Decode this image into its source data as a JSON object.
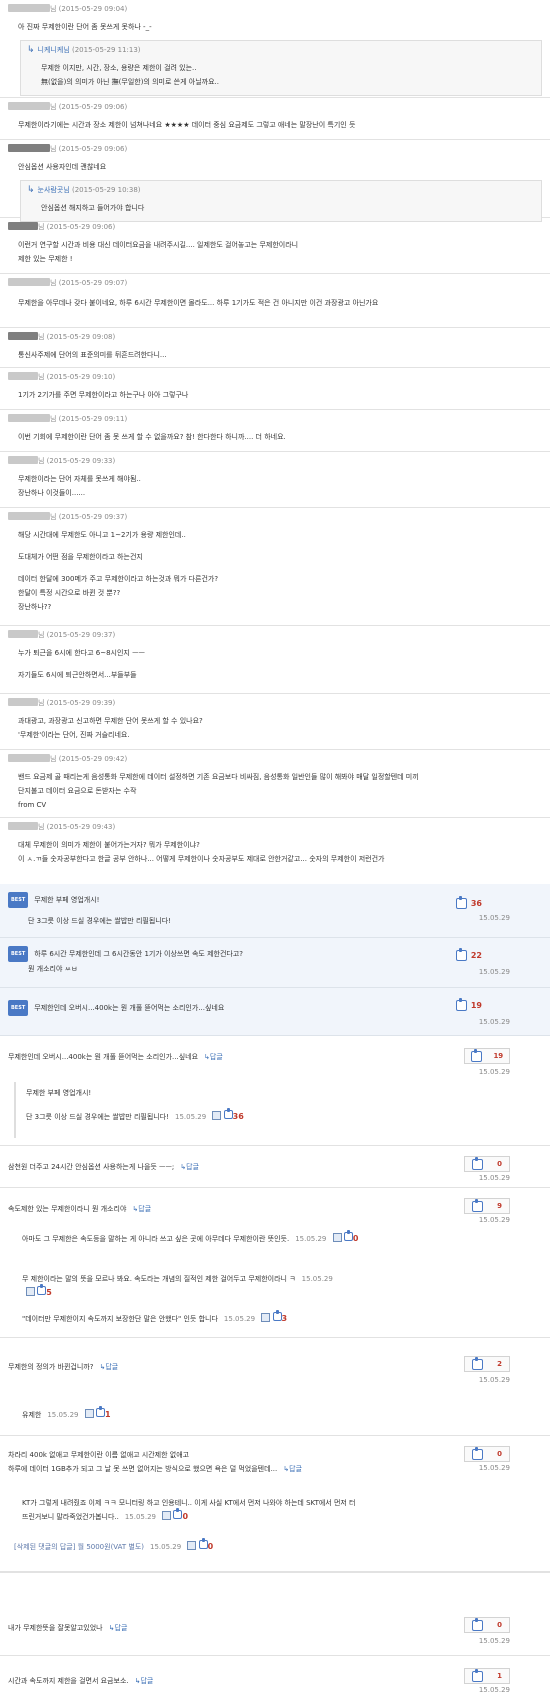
{
  "comments": [
    {
      "date": "(2015-05-29 09:04)",
      "text": "아 진짜 무제한이란 단어 좀 못쓰게 못하나 -_-",
      "reply": {
        "nick": "니케니케님",
        "date": "(2015-05-29 11:13)",
        "lines": [
          "무제한 이지만, 시간, 장소, 용량은 제한이 걸려 있는..",
          "無(없을)의 의미가 아닌 撫(무일한)의 의미로 쓴게 아닐까요.."
        ]
      }
    },
    {
      "nick_suffix": "님",
      "date": "(2015-05-29 09:06)",
      "text": "무제한이라기에는 시간과 장소 제한이 넘쳐나네요 ★★★★ 데이터 중심 요금제도 그렇고 애네는 말장난이 특기인 듯"
    },
    {
      "date": "(2015-05-29 09:06)",
      "text": "안심옵션 사용자인데 괜찮네요",
      "reply": {
        "nick": "눈사람곳님",
        "date": "(2015-05-29 10:38)",
        "lines": [
          "안심옵션 해지하고 들어가야 합니다"
        ]
      }
    },
    {
      "date": "(2015-05-29 09:06)",
      "lines": [
        "이런거 연구할 시간과 비용 대신 데이터요금을 내려주시길.... 일제한도 걸어놓고는 무제한이라니",
        "제한 있는 무제한 !"
      ]
    },
    {
      "nick_suffix": "님",
      "date": "(2015-05-29 09:07)",
      "text": "무제한을 아무데나 갖다 붙이네요, 하루 6시간 무제한이면 몰라도... 하루 1기가도 적은 건 아니지만 이건 과장광고 아닌가요"
    },
    {
      "date": "(2015-05-29 09:08)",
      "text": "통신사주제에 단어의 표준의미를 뒤흔드려한다니..."
    },
    {
      "date": "(2015-05-29 09:10)",
      "text": "1기가 2기가를 주면 무제한이라고 하는구나 아아 그렇구나"
    },
    {
      "date": "(2015-05-29 09:11)",
      "text": "이번 기회에 무제한이란 단어 좀 못 쓰게 할 수 없을까요? 참! 한다한다 하니까.... 더 하네요."
    },
    {
      "date": "(2015-05-29 09:33)",
      "lines": [
        "무제한이라는 단어 자체를 못쓰게 해야됨..",
        "장난하나 이것들이......"
      ]
    },
    {
      "nick_suffix": "님",
      "date": "(2015-05-29 09:37)",
      "paras": [
        [
          "해당 시간대에 무제한도 아니고 1~2기가 용량 제한인데.."
        ],
        [
          "도대체가 어떤 점을 무제한이라고 하는건지"
        ],
        [
          "데이터 한달에 300메가 주고 무제한이라고 하는것과 뭐가 다른건가?",
          "한달이 특정 시간으로 바뀐 것 뿐??",
          "장난하나??"
        ]
      ]
    },
    {
      "date": "(2015-05-29 09:37)",
      "paras": [
        [
          "누가 퇴근을 6시에 한다고 6~8시인지 ㅡㅡ"
        ],
        [
          "자기들도 6시에 퇴근안하면서...부들부들"
        ]
      ]
    },
    {
      "date": "(2015-05-29 09:39)",
      "lines": [
        "과대광고, 과장광고 신고하면 무제한 단어 못쓰게 할 수 있나요?",
        "'무제한'이라는 단어, 진짜 거슬리네요."
      ]
    },
    {
      "nick_suffix": "님",
      "date": "(2015-05-29 09:42)",
      "lines": [
        "밴드 요금제 골 때리는게 음성통화 무제한에 데이터 설정하면 기존 요금보다 비싸짐, 음성통화 일반인들 많이 해봐야 매달 일정할텐데 미끼",
        "단지불고 데이터 요금으로 돈받자는 수작",
        "from CV"
      ]
    },
    {
      "date": "(2015-05-29 09:43)",
      "lines": [
        "대체 무제한이 의미가 제한이 붙어가는거자? 뭐가 무제한이냐?",
        "이 ㅅ.ㄲ들 숫자공부한다고 한글 공부 안하나... 어떻게 무제한이나 숫자공부도 제대로 안한거같고... 숫자의 무제한이 저런건가"
      ]
    }
  ],
  "best": [
    {
      "badge": "BEST",
      "lines": [
        "무제한 부페 영업개시!",
        "단 3그릇 이상 드실 경우에는 쌀밥만 리필됩니다!"
      ],
      "votes": "36",
      "date": "15.05.29"
    },
    {
      "badge": "BEST",
      "lines": [
        "하루 6시간 무제한인데 그 6시간동안 1기가 이상쓰면 속도 제한건다고?",
        "뭔 개소리야 ㅆㅂ"
      ],
      "votes": "22",
      "date": "15.05.29"
    },
    {
      "badge": "BEST",
      "lines": [
        "무제한인데 오버시...400k는 뭔 개풀 뜯어먹는 소리인가...싶네요"
      ],
      "votes": "19",
      "date": "15.05.29"
    }
  ],
  "reply_label": "답글",
  "list": [
    {
      "text": "무제한인데 오버시...400k는 뭔 개풀 뜯어먹는 소리인가...싶네요",
      "votes": "19",
      "date": "15.05.29",
      "subs": [
        {
          "lines": [
            "무제한 부페 영업개시!",
            "단 3그릇 이상 드실 경우에는 쌀밥만 리필됩니다!"
          ],
          "date": "15.05.29",
          "up": "36"
        }
      ]
    },
    {
      "text": "삼천원 더주고 24시간 안심옵션 사용하는게 나을듯 ㅡㅡ;",
      "votes": "0",
      "date": "15.05.29"
    },
    {
      "text": "속도제한 있는 무제한이라니 뭔 개소리야",
      "votes": "9",
      "date": "15.05.29",
      "subs": [
        {
          "lines": [
            "아마도 그 무제한은 속도등을 말하는 게 아니라 쓰고 싶은 곳에 아무데다 무제한이란 뜻인듯."
          ],
          "date": "15.05.29",
          "up": "0"
        },
        {
          "lines": [
            "무 제한이라는 말의 뜻을 모르나 봐요. 속도라는 개념의 질적인 제한 걸어두고 무제한이라니 ㅋ"
          ],
          "date": "15.05.29",
          "up": "5"
        },
        {
          "lines": [
            "\"데이터만 무제한이지 속도까지 보장한단 말은 안했다\" 인듯 합니다"
          ],
          "date": "15.05.29",
          "up": "3"
        }
      ]
    },
    {
      "text": "무제한의 정의가 바뀐겁니까?",
      "votes": "2",
      "date": "15.05.29",
      "subs": [
        {
          "lines": [
            "유제한"
          ],
          "date": "15.05.29",
          "up": "1"
        }
      ]
    },
    {
      "lines": [
        "차라리 400k 없애고 무제한이란 이름 없애고 시간제한 없애고",
        "하루에 데이터 1GB추가 되고 그 날 못 쓰면 없어지는 방식으로 했으면 욕은 덜 먹었을텐데..."
      ],
      "votes": "0",
      "date": "15.05.29",
      "subs": [
        {
          "lines": [
            "KT가 그렇게 내려줬죠 이제 ㅋㅋ 모니터링 하고 인용테니.. 이게 사실 KT에서 먼저 나와야 하는데 SKT에서 먼저 터",
            "뜨린거보니 말라죽었건가봅니다.."
          ],
          "date": "15.05.29",
          "up": "0"
        },
        {
          "lines": [
            "[삭제된 댓글의 답글] 월 5000원(VAT 별도)"
          ],
          "date": "15.05.29",
          "up": "0"
        }
      ]
    },
    {
      "text": "내가 무제한뜻을 잘못알고있었나",
      "votes": "0",
      "date": "15.05.29"
    },
    {
      "text": "시간과 속도까지 제한을 걸면서 요금보소.",
      "votes": "1",
      "date": "15.05.29"
    }
  ]
}
